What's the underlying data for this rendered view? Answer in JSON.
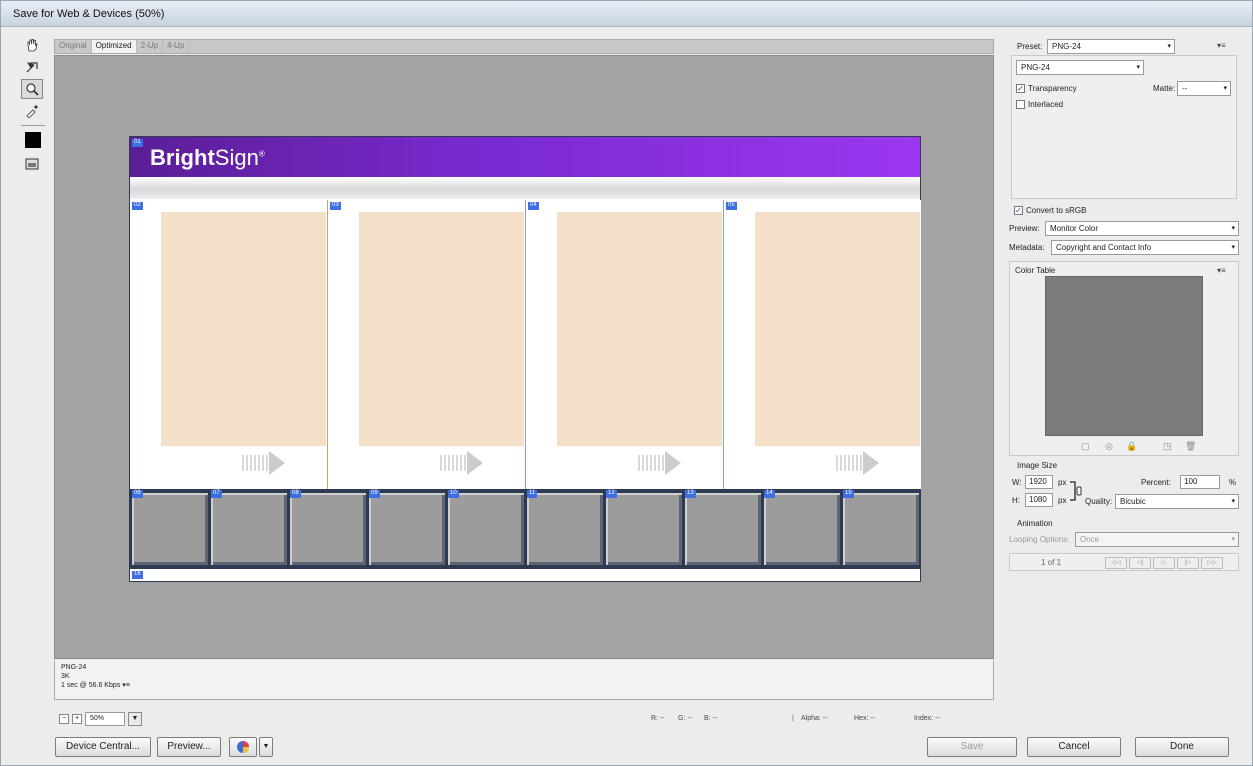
{
  "window": {
    "title": "Save for Web & Devices (50%)"
  },
  "tabs": [
    {
      "label": "Original"
    },
    {
      "label": "Optimized"
    },
    {
      "label": "2-Up"
    },
    {
      "label": "4-Up"
    }
  ],
  "preview": {
    "logo_bold": "Bright",
    "logo_light": "Sign",
    "logo_tm": "®",
    "slices": {
      "top": "01",
      "panels": [
        "02",
        "03",
        "04",
        "05"
      ],
      "thumbs": [
        "06",
        "07",
        "08",
        "09",
        "10",
        "11",
        "12",
        "13",
        "14",
        "15"
      ],
      "bottom": "16"
    }
  },
  "info": {
    "format": "PNG-24",
    "size": "3K",
    "time": "1 sec @ 56.6 Kbps"
  },
  "zoom": {
    "value": "50%"
  },
  "status": {
    "r": "R: --",
    "g": "G: --",
    "b": "B: --",
    "alpha": "Alpha: --",
    "hex": "Hex: --",
    "index": "Index: --"
  },
  "buttons": {
    "device_central": "Device Central...",
    "preview": "Preview...",
    "save": "Save",
    "cancel": "Cancel",
    "done": "Done"
  },
  "settings": {
    "preset_label": "Preset:",
    "preset_value": "PNG-24",
    "format_value": "PNG-24",
    "transparency_label": "Transparency",
    "transparency_checked": "✓",
    "matte_label": "Matte:",
    "matte_value": "--",
    "interlaced_label": "Interlaced",
    "convert_srgb_label": "Convert to sRGB",
    "convert_srgb_checked": "✓",
    "preview_label": "Preview:",
    "preview_value": "Monitor Color",
    "metadata_label": "Metadata:",
    "metadata_value": "Copyright and Contact Info",
    "color_table_label": "Color Table"
  },
  "image_size": {
    "section_label": "Image Size",
    "w_label": "W:",
    "w_value": "1920",
    "h_label": "H:",
    "h_value": "1080",
    "px": "px",
    "percent_label": "Percent:",
    "percent_value": "100",
    "percent_unit": "%",
    "quality_label": "Quality:",
    "quality_value": "Bicubic"
  },
  "animation": {
    "section_label": "Animation",
    "looping_label": "Looping Options:",
    "looping_value": "Once",
    "frame_counter": "1 of 1"
  },
  "colors": {
    "banner_start": "#5a1e96",
    "banner_end": "#9b37f0",
    "peach": "#f4e0c8",
    "slice_tag": "#3d6fe0"
  }
}
